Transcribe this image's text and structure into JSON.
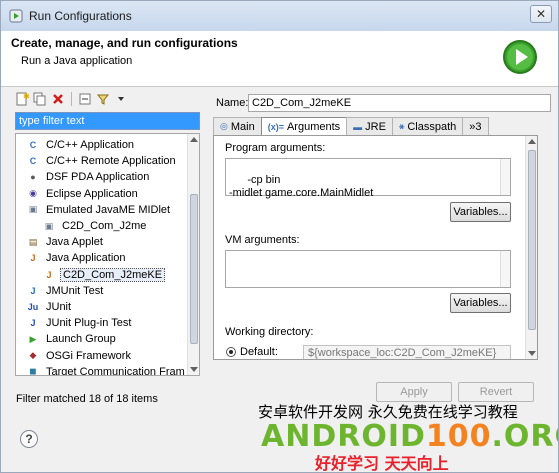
{
  "window": {
    "title": "Run Configurations",
    "close_glyph": "✕"
  },
  "header": {
    "title": "Create, manage, and run configurations",
    "subtitle": "Run a Java application",
    "run_icon": "run-icon",
    "accent": "#3aa02c"
  },
  "toolbar": {
    "icons": [
      "new-config-icon",
      "duplicate-icon",
      "delete-icon",
      "collapse-all-icon",
      "filter-icon",
      "dropdown-icon"
    ]
  },
  "filter": {
    "placeholder": "type filter text"
  },
  "tree": {
    "items": [
      {
        "label": "C/C++ Application",
        "icon": "c-app-icon",
        "indent": 1,
        "selected": false
      },
      {
        "label": "C/C++ Remote Application",
        "icon": "c-remote-icon",
        "indent": 1,
        "selected": false
      },
      {
        "label": "DSF PDA Application",
        "icon": "dsf-icon",
        "indent": 1,
        "selected": false
      },
      {
        "label": "Eclipse Application",
        "icon": "eclipse-icon",
        "indent": 1,
        "selected": false
      },
      {
        "label": "Emulated JavaME MIDlet",
        "icon": "midlet-icon",
        "indent": 1,
        "selected": false
      },
      {
        "label": "C2D_Com_J2me",
        "icon": "midlet-config-icon",
        "indent": 2,
        "selected": false
      },
      {
        "label": "Java Applet",
        "icon": "applet-icon",
        "indent": 1,
        "selected": false
      },
      {
        "label": "Java Application",
        "icon": "java-app-icon",
        "indent": 1,
        "selected": false
      },
      {
        "label": "C2D_Com_J2meKE",
        "icon": "java-config-icon",
        "indent": 2,
        "selected": true
      },
      {
        "label": "JMUnit Test",
        "icon": "jmunit-icon",
        "indent": 1,
        "selected": false
      },
      {
        "label": "JUnit",
        "icon": "junit-icon",
        "indent": 1,
        "selected": false
      },
      {
        "label": "JUnit Plug-in Test",
        "icon": "junit-plugin-icon",
        "indent": 1,
        "selected": false
      },
      {
        "label": "Launch Group",
        "icon": "launch-group-icon",
        "indent": 1,
        "selected": false
      },
      {
        "label": "OSGi Framework",
        "icon": "osgi-icon",
        "indent": 1,
        "selected": false
      },
      {
        "label": "Target Communication Fram",
        "icon": "tcf-icon",
        "indent": 1,
        "selected": false
      }
    ]
  },
  "status": {
    "filter_matched": "Filter matched 18 of 18 items"
  },
  "name_field": {
    "label": "Name:",
    "value": "C2D_Com_J2meKE"
  },
  "tabs": [
    {
      "label": "Main",
      "icon": "main-tab-icon",
      "active": false
    },
    {
      "label": "Arguments",
      "icon": "arguments-tab-icon",
      "active": true
    },
    {
      "label": "JRE",
      "icon": "jre-tab-icon",
      "active": false
    },
    {
      "label": "Classpath",
      "icon": "classpath-tab-icon",
      "active": false
    },
    {
      "label": "»3",
      "icon": "",
      "active": false
    }
  ],
  "arguments": {
    "program_label": "Program arguments:",
    "program_value": "-cp bin\n-midlet game.core.MainMidlet",
    "variables_label": "Variables...",
    "vm_label": "VM arguments:",
    "vm_value": "",
    "vm_variables_label": "Variables...",
    "working_dir_label": "Working directory:",
    "default_label": "Default:",
    "default_selected": true,
    "default_value": "${workspace_loc:C2D_Com_J2meKE}"
  },
  "buttons": {
    "apply": "Apply",
    "revert": "Revert"
  },
  "watermark": {
    "line1": "安卓软件开发网  永久免费在线学习教程",
    "line2_green": "ANDROID",
    "line2_orange": "100",
    "line2_green2": ".ORG",
    "line3": "好好学习  天天向上"
  }
}
